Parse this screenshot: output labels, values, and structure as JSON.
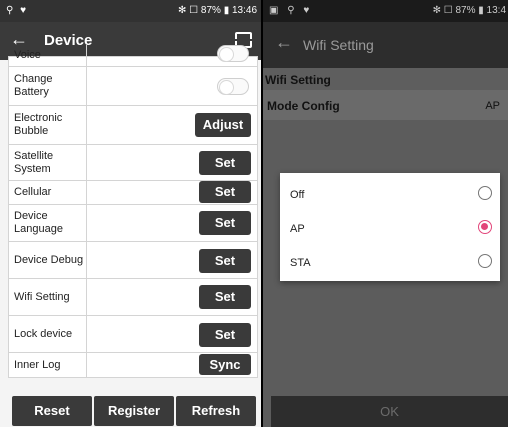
{
  "left": {
    "status": {
      "left_icons": "⚲ ♥",
      "right": "✻ ☐ 87% ▮ 13:46"
    },
    "appbar": {
      "back": "←",
      "title": "Device"
    },
    "rows": [
      {
        "label": "Voice",
        "control": "toggle"
      },
      {
        "label": "Change Battery",
        "control": "toggle"
      },
      {
        "label": "Electronic Bubble",
        "control": "button",
        "button": "Adjust"
      },
      {
        "label": "Satellite System",
        "control": "button",
        "button": "Set"
      },
      {
        "label": "Cellular",
        "control": "button",
        "button": "Set"
      },
      {
        "label": "Device Language",
        "control": "button",
        "button": "Set"
      },
      {
        "label": "Device Debug",
        "control": "button",
        "button": "Set"
      },
      {
        "label": "Wifi Setting",
        "control": "button",
        "button": "Set"
      },
      {
        "label": "Lock device",
        "control": "button",
        "button": "Set"
      },
      {
        "label": "Inner Log",
        "control": "button",
        "button": "Sync"
      }
    ],
    "bottom": {
      "reset": "Reset",
      "register": "Register",
      "refresh": "Refresh"
    }
  },
  "right": {
    "status": {
      "left_icons": "▣ ⚲ ♥",
      "right": "✻ ☐ 87% ▮ 13:4"
    },
    "appbar": {
      "back": "←",
      "title": "Wifi Setting"
    },
    "section": "Wifi Setting",
    "mode": {
      "label": "Mode Config",
      "value": "AP"
    },
    "dialog": {
      "options": [
        {
          "label": "Off",
          "selected": false
        },
        {
          "label": "AP",
          "selected": true
        },
        {
          "label": "STA",
          "selected": false
        }
      ]
    },
    "ok": "OK"
  },
  "colors": {
    "accent": "#e2457a",
    "dark": "#3a3a3a"
  }
}
